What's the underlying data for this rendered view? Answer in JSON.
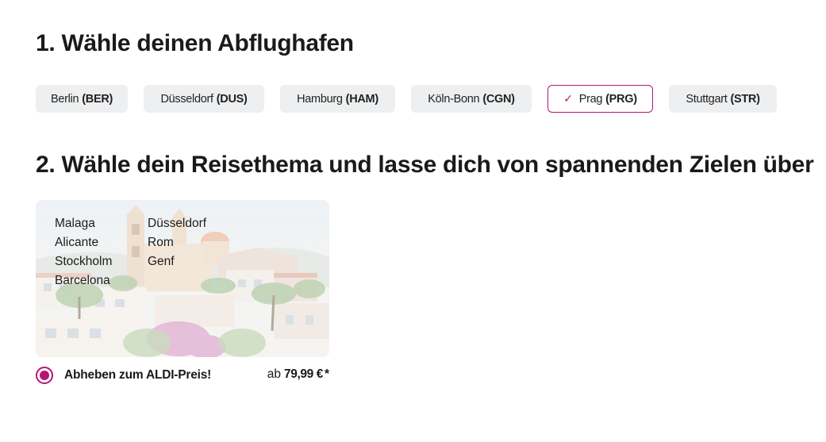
{
  "step1": {
    "title": "1. Wähle deinen Abflughafen",
    "airports": [
      {
        "city": "Berlin",
        "code": "(BER)",
        "selected": false
      },
      {
        "city": "Düsseldorf",
        "code": "(DUS)",
        "selected": false
      },
      {
        "city": "Hamburg",
        "code": "(HAM)",
        "selected": false
      },
      {
        "city": "Köln-Bonn",
        "code": "(CGN)",
        "selected": false
      },
      {
        "city": "Prag",
        "code": "(PRG)",
        "selected": true
      },
      {
        "city": "Stuttgart",
        "code": "(STR)",
        "selected": false
      }
    ],
    "check_icon": "✓"
  },
  "step2": {
    "title": "2. Wähle dein Reisethema und lasse dich von spannenden Zielen über"
  },
  "card": {
    "destinations_left": [
      "Malaga",
      "Alicante",
      "Stockholm",
      "Barcelona"
    ],
    "destinations_right": [
      "Düsseldorf",
      "Rom",
      "Genf"
    ],
    "image_description": "mediterranean-town-photo"
  },
  "offer": {
    "label": "Abheben zum ALDI-Preis!",
    "price_prefix": "ab",
    "price": "79,99 €",
    "asterisk": "*",
    "selected": true
  },
  "colors": {
    "accent": "#b31772",
    "chip_bg": "#eeeff1",
    "text": "#1a1a1a"
  }
}
